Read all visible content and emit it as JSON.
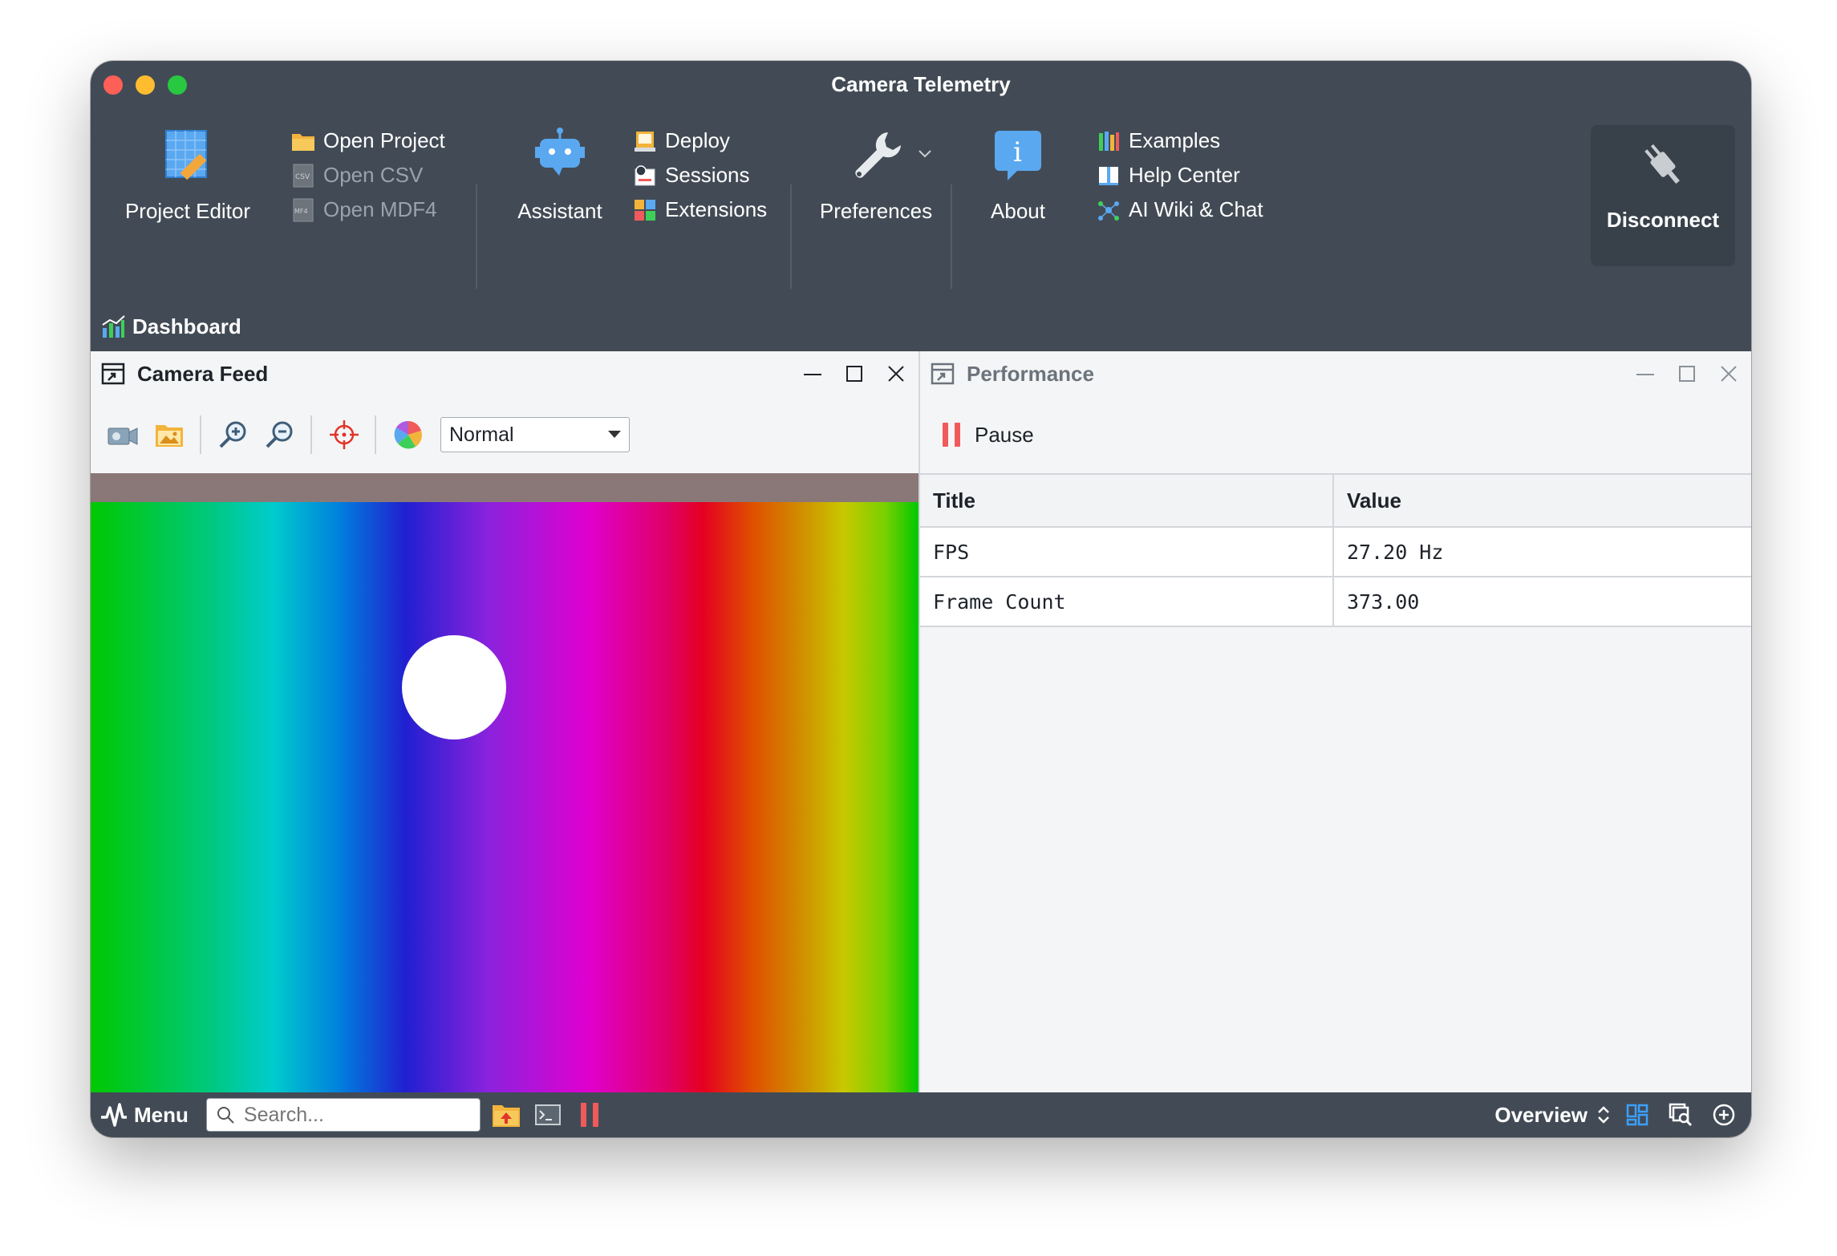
{
  "window": {
    "title": "Camera Telemetry"
  },
  "toolbar": {
    "project_editor": "Project Editor",
    "open_project": "Open Project",
    "open_csv": "Open CSV",
    "open_mdf4": "Open MDF4",
    "assistant": "Assistant",
    "deploy": "Deploy",
    "sessions": "Sessions",
    "extensions": "Extensions",
    "preferences": "Preferences",
    "about": "About",
    "examples": "Examples",
    "help_center": "Help Center",
    "ai_wiki": "AI Wiki & Chat",
    "disconnect": "Disconnect"
  },
  "dashboard": {
    "title": "Dashboard"
  },
  "camera_panel": {
    "title": "Camera Feed",
    "mode": "Normal"
  },
  "performance_panel": {
    "title": "Performance",
    "pause_label": "Pause",
    "columns": [
      "Title",
      "Value"
    ],
    "rows": [
      {
        "title": "FPS",
        "value": "27.20 Hz"
      },
      {
        "title": "Frame Count",
        "value": "373.00"
      }
    ]
  },
  "taskbar": {
    "menu": "Menu",
    "search_placeholder": "Search...",
    "overview": "Overview"
  },
  "colors": {
    "chrome": "#424b55",
    "accent_blue": "#3aa0ff",
    "pause_red": "#f05a5a"
  }
}
